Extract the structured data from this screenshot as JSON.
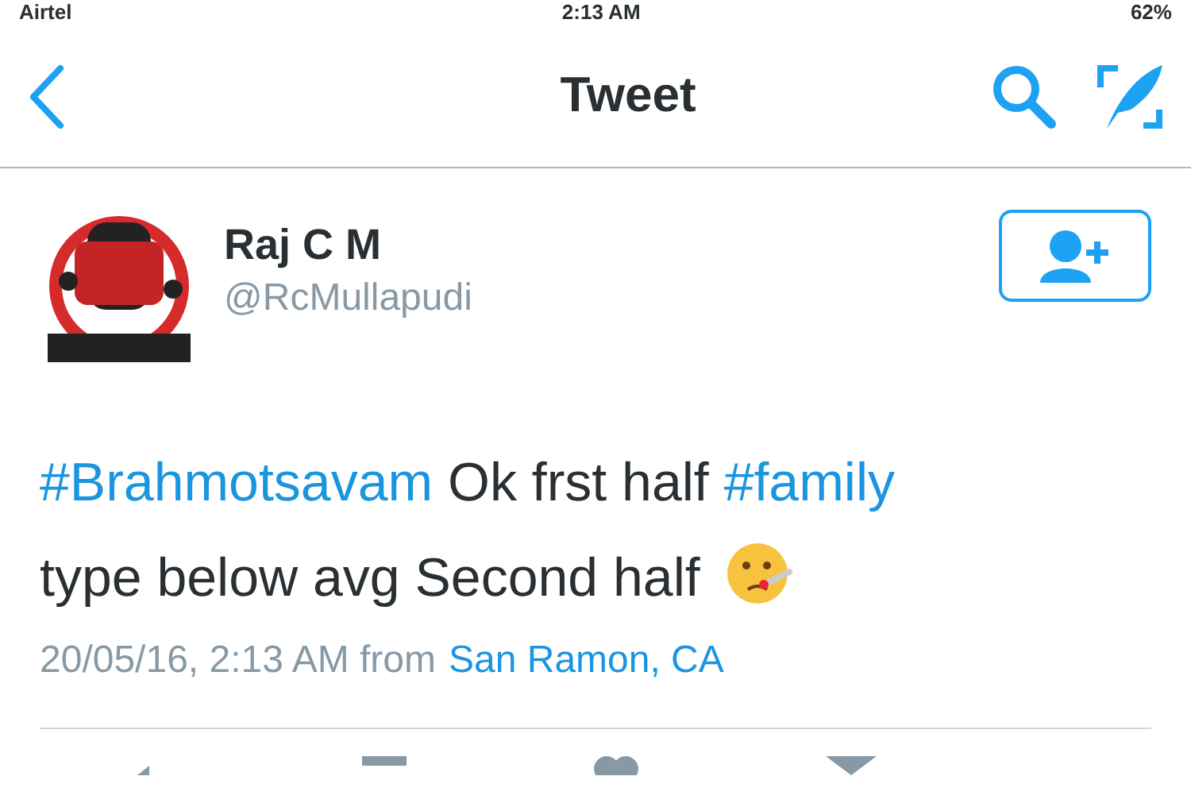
{
  "status_bar": {
    "carrier": "Airtel",
    "time": "2:13 AM",
    "battery": "62%"
  },
  "nav": {
    "title": "Tweet"
  },
  "tweet": {
    "name": "Raj C M",
    "handle": "@RcMullapudi",
    "text": [
      {
        "kind": "hashtag",
        "text": "#Brahmotsavam"
      },
      {
        "kind": "plain",
        "text": " Ok frst half "
      },
      {
        "kind": "hashtag",
        "text": "#family"
      },
      {
        "kind": "plain",
        "text": " type below avg Second half"
      },
      {
        "kind": "emoji"
      }
    ],
    "timestamp": "20/05/16, 2:13 AM from",
    "location": "San Ramon, CA"
  }
}
